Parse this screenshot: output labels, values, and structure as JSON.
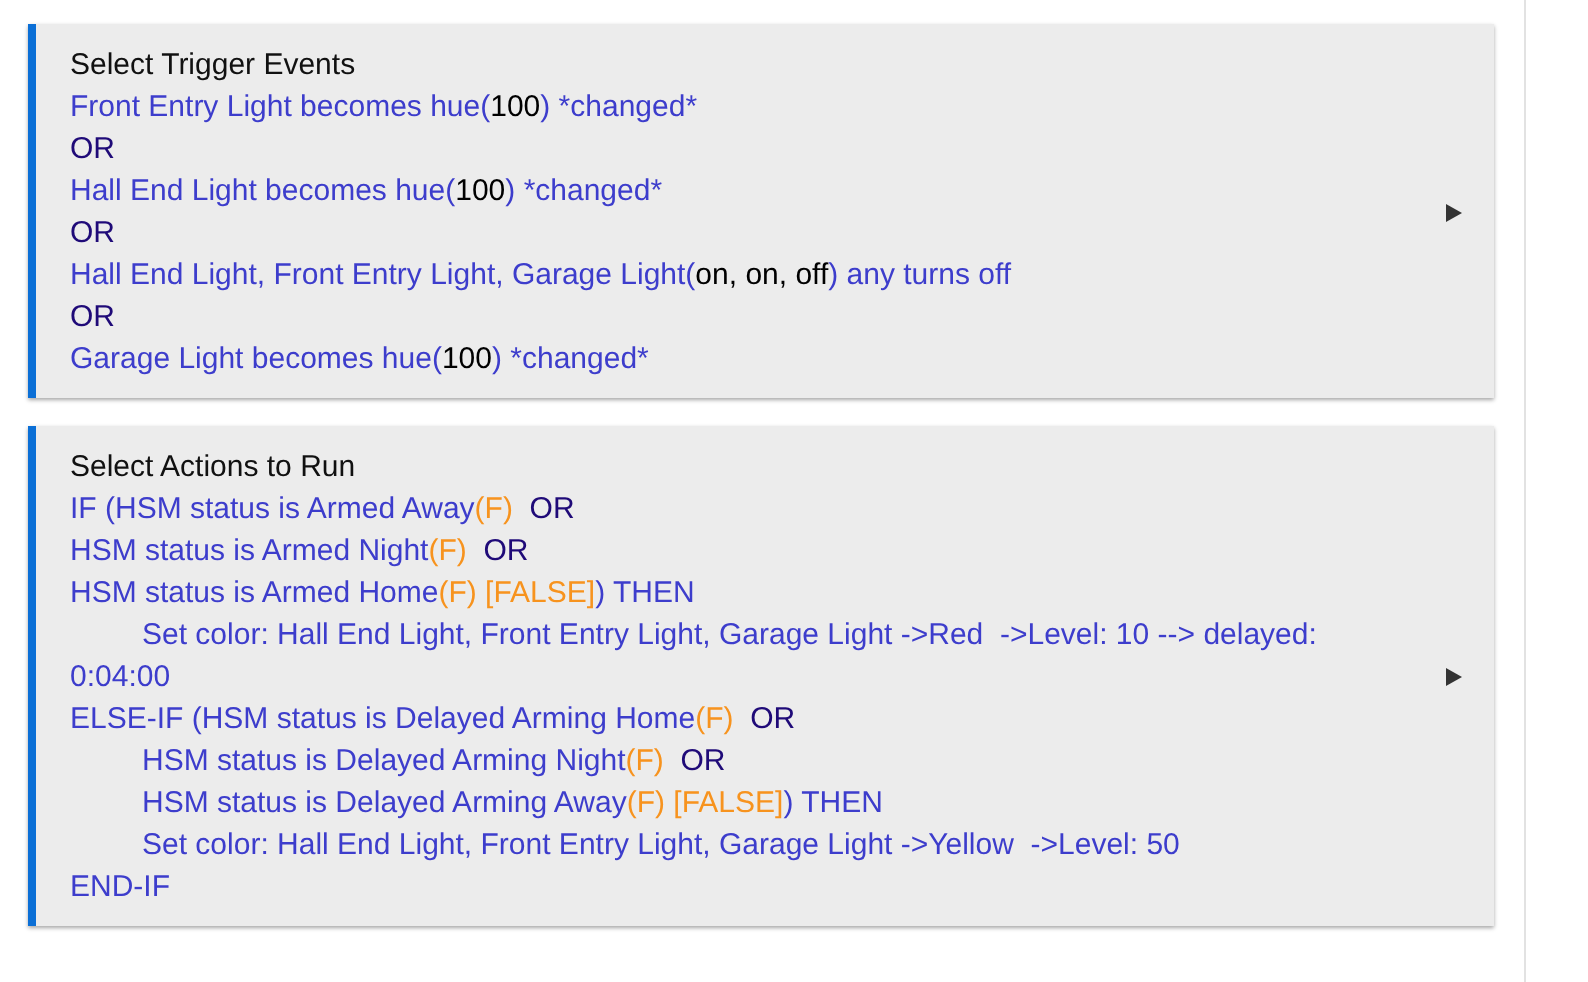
{
  "sections": [
    {
      "title": "Select Trigger Events",
      "lines": [
        {
          "indented": false,
          "segments": [
            {
              "kind": "text",
              "s": "Front Entry Light becomes hue("
            },
            {
              "kind": "value",
              "s": "100"
            },
            {
              "kind": "text",
              "s": ") *changed*"
            }
          ]
        },
        {
          "indented": false,
          "segments": [
            {
              "kind": "keyword",
              "s": "OR"
            }
          ]
        },
        {
          "indented": false,
          "segments": [
            {
              "kind": "text",
              "s": "Hall End Light becomes hue("
            },
            {
              "kind": "value",
              "s": "100"
            },
            {
              "kind": "text",
              "s": ") *changed*"
            }
          ]
        },
        {
          "indented": false,
          "segments": [
            {
              "kind": "keyword",
              "s": "OR"
            }
          ]
        },
        {
          "indented": false,
          "segments": [
            {
              "kind": "text",
              "s": "Hall End Light, Front Entry Light, Garage Light("
            },
            {
              "kind": "value",
              "s": "on, on, off"
            },
            {
              "kind": "text",
              "s": ") any turns off"
            }
          ]
        },
        {
          "indented": false,
          "segments": [
            {
              "kind": "keyword",
              "s": "OR"
            }
          ]
        },
        {
          "indented": false,
          "segments": [
            {
              "kind": "text",
              "s": "Garage Light becomes hue("
            },
            {
              "kind": "value",
              "s": "100"
            },
            {
              "kind": "text",
              "s": ") *changed*"
            }
          ]
        }
      ]
    },
    {
      "title": "Select Actions to Run",
      "lines": [
        {
          "indented": false,
          "segments": [
            {
              "kind": "text",
              "s": "IF (HSM status is Armed Away"
            },
            {
              "kind": "flag",
              "s": "(F)"
            },
            {
              "kind": "keyword",
              "s": "  OR"
            }
          ]
        },
        {
          "indented": false,
          "segments": [
            {
              "kind": "text",
              "s": "HSM status is Armed Night"
            },
            {
              "kind": "flag",
              "s": "(F)"
            },
            {
              "kind": "keyword",
              "s": "  OR"
            }
          ]
        },
        {
          "indented": false,
          "segments": [
            {
              "kind": "text",
              "s": "HSM status is Armed Home"
            },
            {
              "kind": "flag",
              "s": "(F) [FALSE]"
            },
            {
              "kind": "text",
              "s": ") THEN"
            }
          ]
        },
        {
          "indented": true,
          "segments": [
            {
              "kind": "text",
              "s": "Set color: Hall End Light, Front Entry Light, Garage Light ->Red  ->Level: 10 --> delayed: 0:04:00"
            }
          ]
        },
        {
          "indented": false,
          "segments": [
            {
              "kind": "text",
              "s": "ELSE-IF (HSM status is Delayed Arming Home"
            },
            {
              "kind": "flag",
              "s": "(F)"
            },
            {
              "kind": "keyword",
              "s": "  OR"
            }
          ]
        },
        {
          "indented": true,
          "segments": [
            {
              "kind": "text",
              "s": "HSM status is Delayed Arming Night"
            },
            {
              "kind": "flag",
              "s": "(F)"
            },
            {
              "kind": "keyword",
              "s": "  OR"
            }
          ]
        },
        {
          "indented": true,
          "segments": [
            {
              "kind": "text",
              "s": "HSM status is Delayed Arming Away"
            },
            {
              "kind": "flag",
              "s": "(F) [FALSE]"
            },
            {
              "kind": "text",
              "s": ") THEN"
            }
          ]
        },
        {
          "indented": true,
          "segments": [
            {
              "kind": "text",
              "s": "Set color: Hall End Light, Front Entry Light, Garage Light ->Yellow  ->Level: 50"
            }
          ]
        },
        {
          "indented": false,
          "segments": [
            {
              "kind": "text",
              "s": "END-IF"
            }
          ]
        }
      ]
    }
  ]
}
